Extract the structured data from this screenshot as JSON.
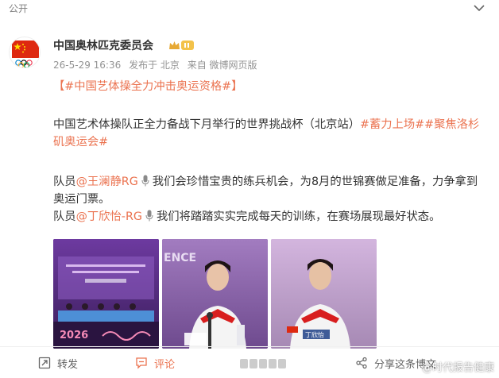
{
  "topbar": {
    "visibility": "公开"
  },
  "author": {
    "name": "中国奥林匹克委员会"
  },
  "meta": {
    "time": "26-5-29 16:36",
    "location": "发布于 北京",
    "source": "来自 微博网页版"
  },
  "post": {
    "headline": "【#中国艺体操全力冲击奥运资格#】",
    "para1_text": "中国艺术体操队正全力备战下月举行的世界挑战杯（北京站）",
    "para1_tags": "#蓄力上场##聚焦洛杉矶奥运会#",
    "line1_prefix": "队员",
    "line1_mention": "@王澜静RG",
    "line1_quote": "我们会珍惜宝贵的练兵机会，为8月的世锦赛做足准备，力争拿到奥运门票。",
    "line2_prefix": "队员",
    "line2_mention": "@丁欣怡-RG",
    "line2_quote": "我们将踏踏实实完成每天的训练，在赛场展现最好状态。"
  },
  "photos": {
    "p1_caption": "2026",
    "p2_backdrop": "ENCE",
    "p3_nameplate": "丁欣怡"
  },
  "actions": {
    "repost": "转发",
    "comment": "评论",
    "share": "分享这条博文"
  },
  "watermark": "@时代报告健康",
  "colors": {
    "link": "#eb7350",
    "meta": "#939393",
    "accent_red": "#de2910"
  }
}
